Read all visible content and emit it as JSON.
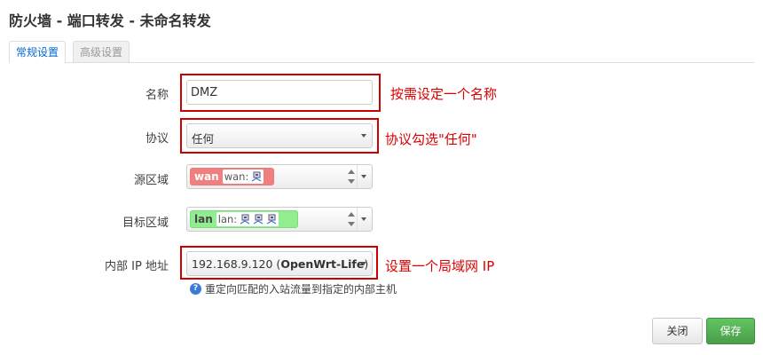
{
  "page": {
    "title": "防火墙 - 端口转发 - 未命名转发"
  },
  "tabs": [
    {
      "label": "常规设置",
      "active": true
    },
    {
      "label": "高级设置",
      "active": false
    }
  ],
  "form": {
    "name": {
      "label": "名称",
      "value": "DMZ"
    },
    "protocol": {
      "label": "协议",
      "value": "任何"
    },
    "src_zone": {
      "label": "源区域",
      "zone": "wan",
      "networks": "wan:",
      "color": "#f08080"
    },
    "dest_zone": {
      "label": "目标区域",
      "zone": "lan",
      "networks": "lan:",
      "color": "#90ee90"
    },
    "internal_ip": {
      "label": "内部 IP 地址",
      "value_ip": "192.168.9.120 (",
      "value_host": "OpenWrt-Life",
      "value_tail": ")"
    },
    "hint": "重定向匹配的入站流量到指定的内部主机"
  },
  "annotations": {
    "name": "按需设定一个名称",
    "protocol": "协议勾选\"任何\"",
    "ip": "设置一个局域网 IP"
  },
  "buttons": {
    "close": "关闭",
    "save": "保存"
  },
  "icons": {
    "network": "network-interface-icon",
    "help": "help-circle-icon"
  },
  "colors": {
    "accent": "#0069d6",
    "annotation": "#cc0000",
    "save": "#5cb85c"
  }
}
